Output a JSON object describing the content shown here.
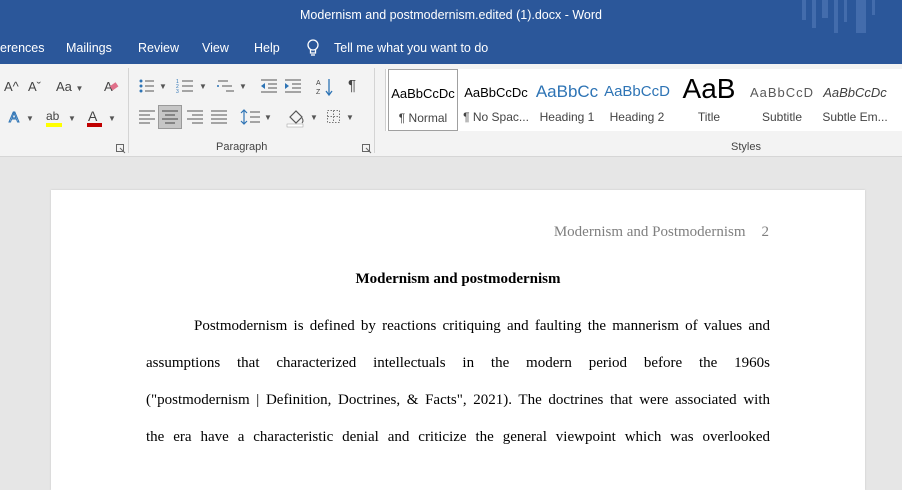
{
  "window": {
    "title": "Modernism and postmodernism.edited (1).docx  -  Word"
  },
  "menu": {
    "items": [
      "erences",
      "Mailings",
      "Review",
      "View",
      "Help"
    ],
    "tell_me": "Tell me what you want to do"
  },
  "ribbon": {
    "paragraph_label": "Paragraph",
    "styles_label": "Styles",
    "styles": [
      {
        "sample": "AaBbCcDc",
        "name": "¶ Normal"
      },
      {
        "sample": "AaBbCcDc",
        "name": "¶ No Spac..."
      },
      {
        "sample": "AaBbCc",
        "name": "Heading 1"
      },
      {
        "sample": "AaBbCcD",
        "name": "Heading 2"
      },
      {
        "sample": "AaB",
        "name": "Title"
      },
      {
        "sample": "AaBbCcD",
        "name": "Subtitle"
      },
      {
        "sample": "AaBbCcDc",
        "name": "Subtle Em..."
      }
    ],
    "icons": {
      "grow_font": "A^",
      "shrink_font": "Aˇ",
      "change_case": "Aa",
      "paragraph_mark": "¶"
    }
  },
  "colors": {
    "title_bar": "#2b579a",
    "highlight": "#ffff00",
    "font_color": "#c00000",
    "heading_blue": "#2e74b5"
  },
  "document": {
    "header_text": "Modernism and Postmodernism",
    "page_number": "2",
    "title": "Modernism and postmodernism",
    "lines": [
      "Postmodernism is defined by reactions critiquing and faulting the mannerism of values and",
      "assumptions that characterized intellectuals in the modern period before the 1960s",
      "(\"postmodernism | Definition, Doctrines, & Facts\", 2021). The doctrines that were associated with",
      "the era have a characteristic denial and criticize the general viewpoint which was overlooked"
    ]
  }
}
